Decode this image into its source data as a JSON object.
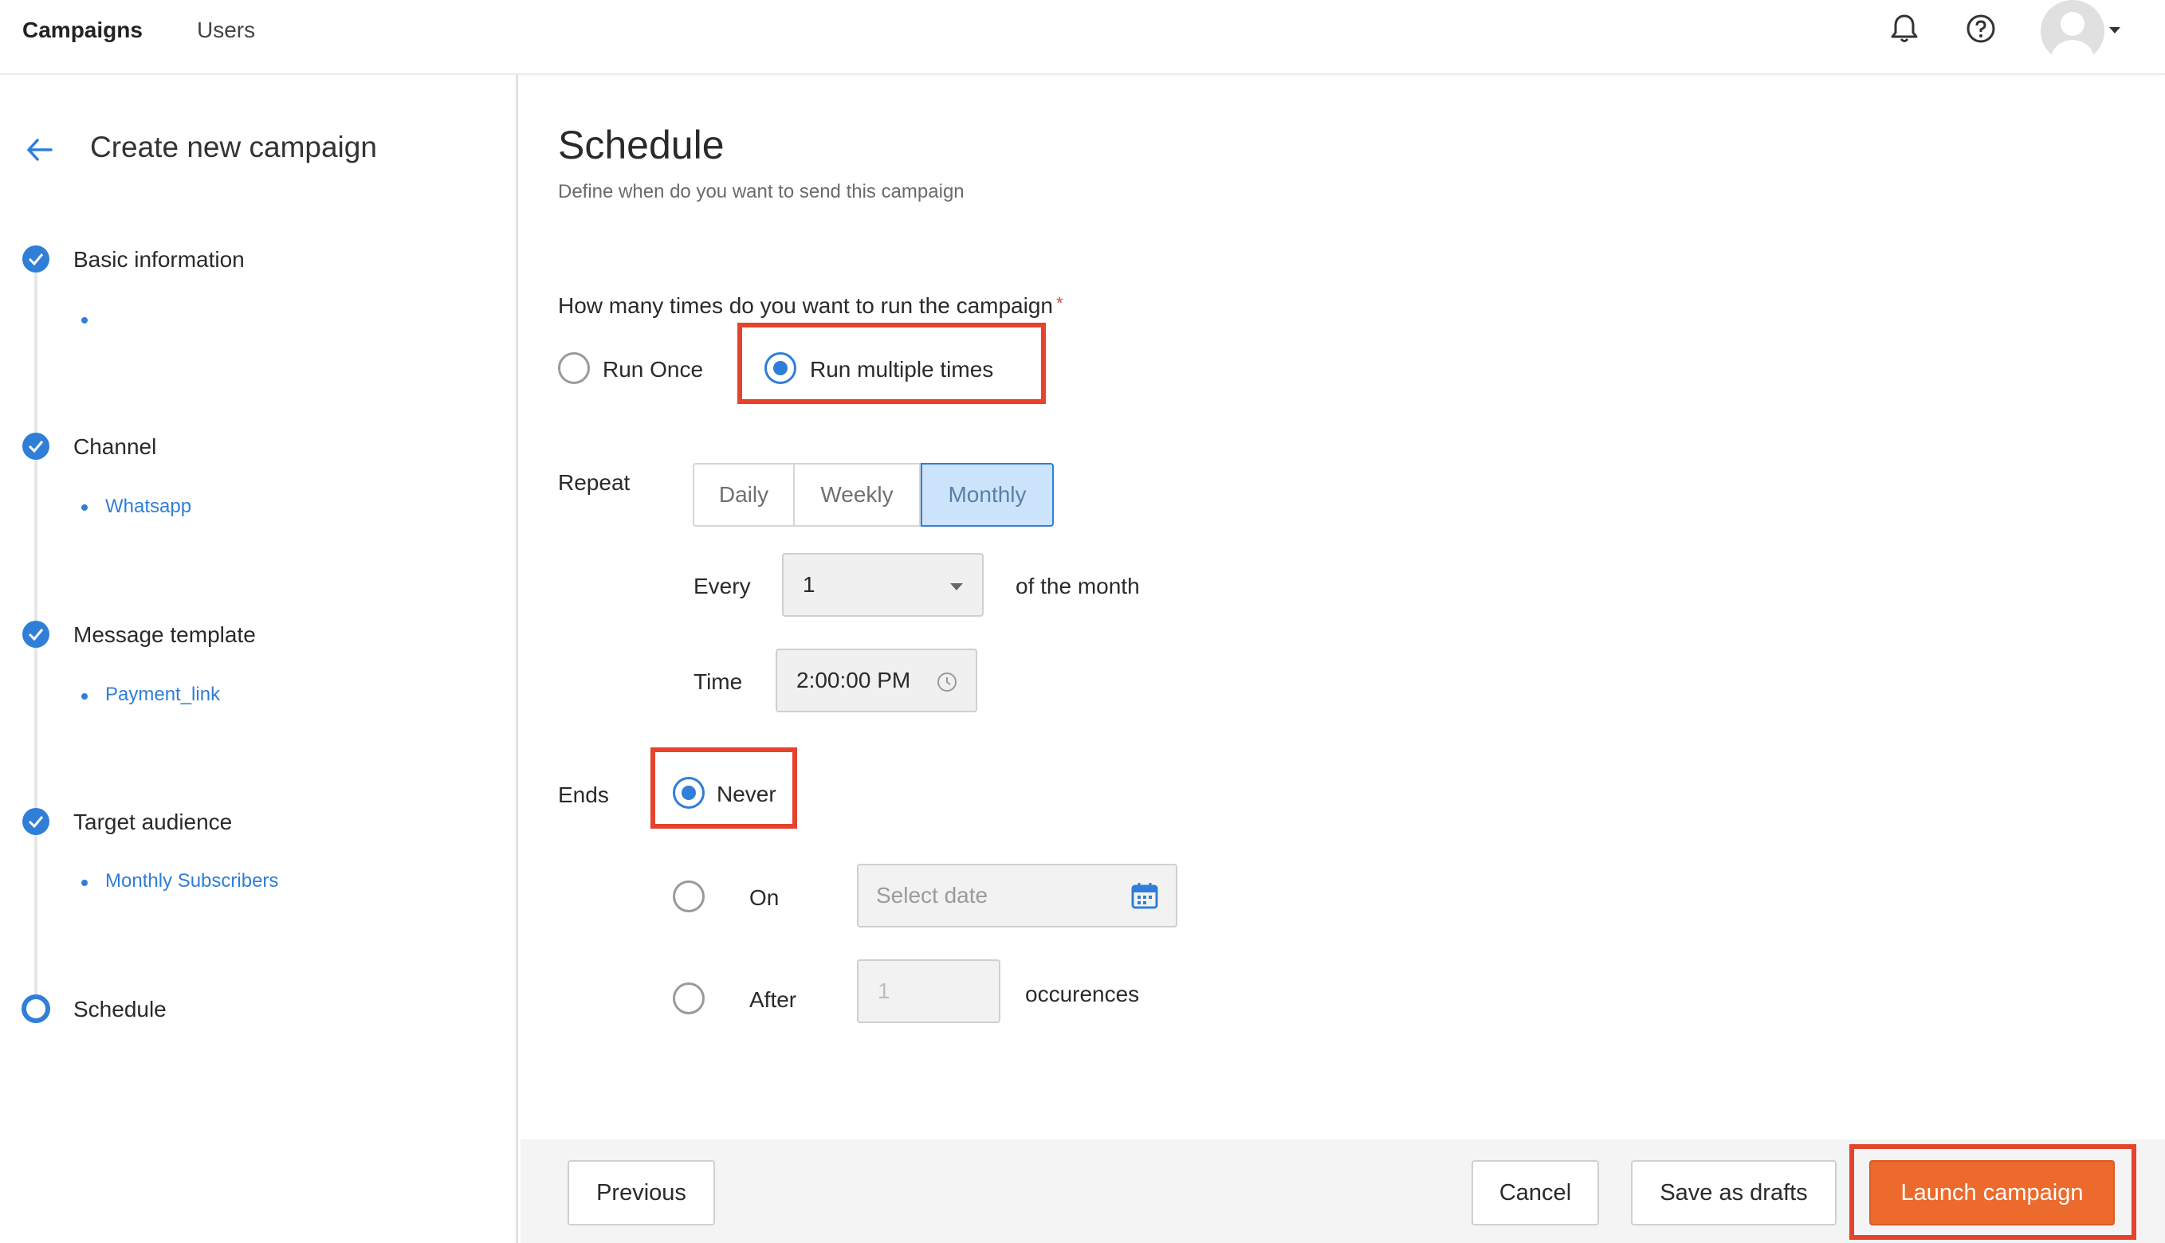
{
  "topbar": {
    "nav": [
      "Campaigns",
      "Users"
    ],
    "icons": [
      "bell-icon",
      "help-icon",
      "avatar"
    ]
  },
  "sidebar": {
    "title": "Create new campaign",
    "steps": [
      {
        "label": "Basic information",
        "sub": ""
      },
      {
        "label": "Channel",
        "sub": "Whatsapp"
      },
      {
        "label": "Message template",
        "sub": "Payment_link"
      },
      {
        "label": "Target audience",
        "sub": "Monthly Subscribers"
      },
      {
        "label": "Schedule",
        "sub": ""
      }
    ]
  },
  "main": {
    "title": "Schedule",
    "subtitle": "Define when do you want to send this campaign",
    "question": "How many times do you want to run the campaign",
    "required_mark": "*",
    "run_options": {
      "once": "Run Once",
      "multiple": "Run multiple times",
      "selected": "multiple"
    },
    "repeat": {
      "label": "Repeat",
      "options": [
        "Daily",
        "Weekly",
        "Monthly"
      ],
      "selected": "Monthly"
    },
    "every": {
      "label": "Every",
      "value": "1",
      "suffix": "of the month"
    },
    "time": {
      "label": "Time",
      "value": "2:00:00 PM"
    },
    "ends": {
      "label": "Ends",
      "never": "Never",
      "on": "On",
      "on_placeholder": "Select date",
      "after": "After",
      "after_placeholder": "1",
      "after_suffix": "occurences",
      "selected": "never"
    }
  },
  "footer": {
    "previous": "Previous",
    "cancel": "Cancel",
    "save": "Save as drafts",
    "launch": "Launch campaign"
  },
  "colors": {
    "accent": "#2f7ed8",
    "primary_button": "#ec6a2c",
    "highlight": "#e5432c",
    "selected_segment": "#cce4fb"
  }
}
